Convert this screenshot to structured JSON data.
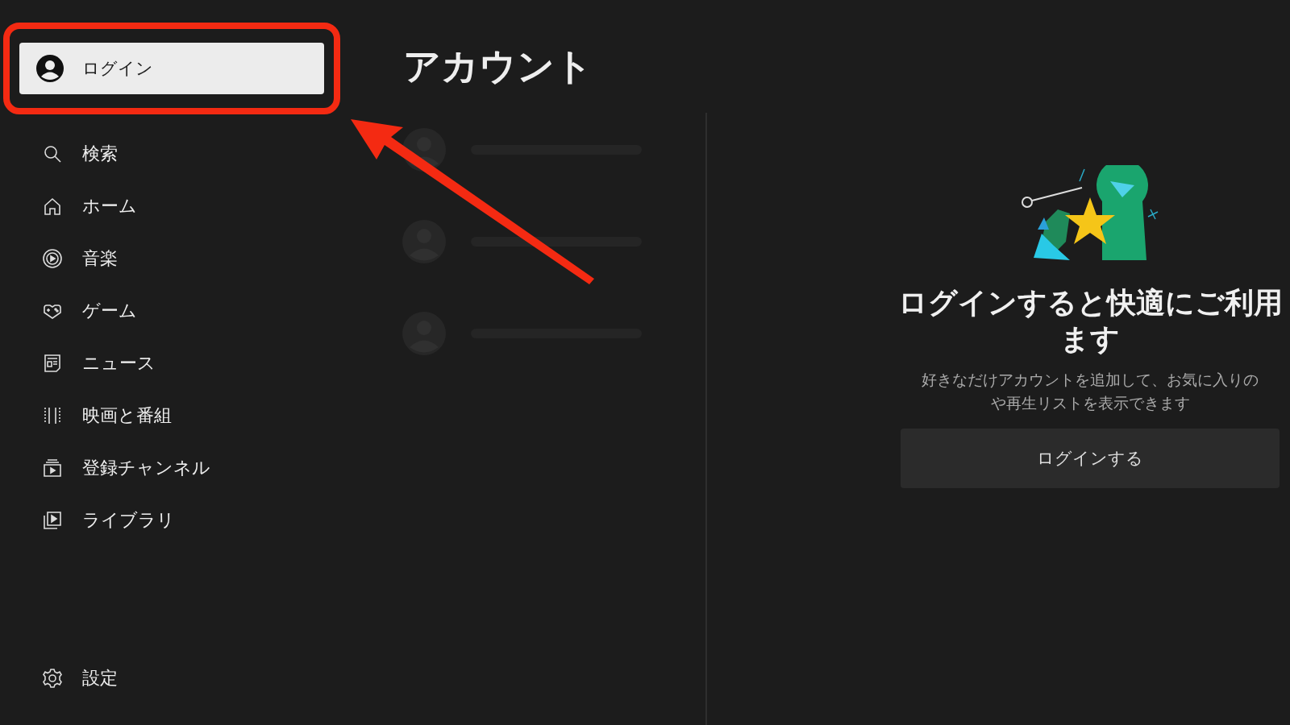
{
  "sidebar": {
    "account_button": {
      "label": "ログイン"
    },
    "nav_items": [
      {
        "label": "検索"
      },
      {
        "label": "ホーム"
      },
      {
        "label": "音楽"
      },
      {
        "label": "ゲーム"
      },
      {
        "label": "ニュース"
      },
      {
        "label": "映画と番組"
      },
      {
        "label": "登録チャンネル"
      },
      {
        "label": "ライブラリ"
      }
    ],
    "settings_item": {
      "label": "設定"
    }
  },
  "page_title": "アカウント",
  "sign_in_panel": {
    "heading_lines": [
      "ログインすると快適にご利用",
      "ます"
    ],
    "description_lines": [
      "好きなだけアカウントを追加して、お気に入りの",
      "や再生リストを表示できます"
    ],
    "button": "ログインする"
  }
}
